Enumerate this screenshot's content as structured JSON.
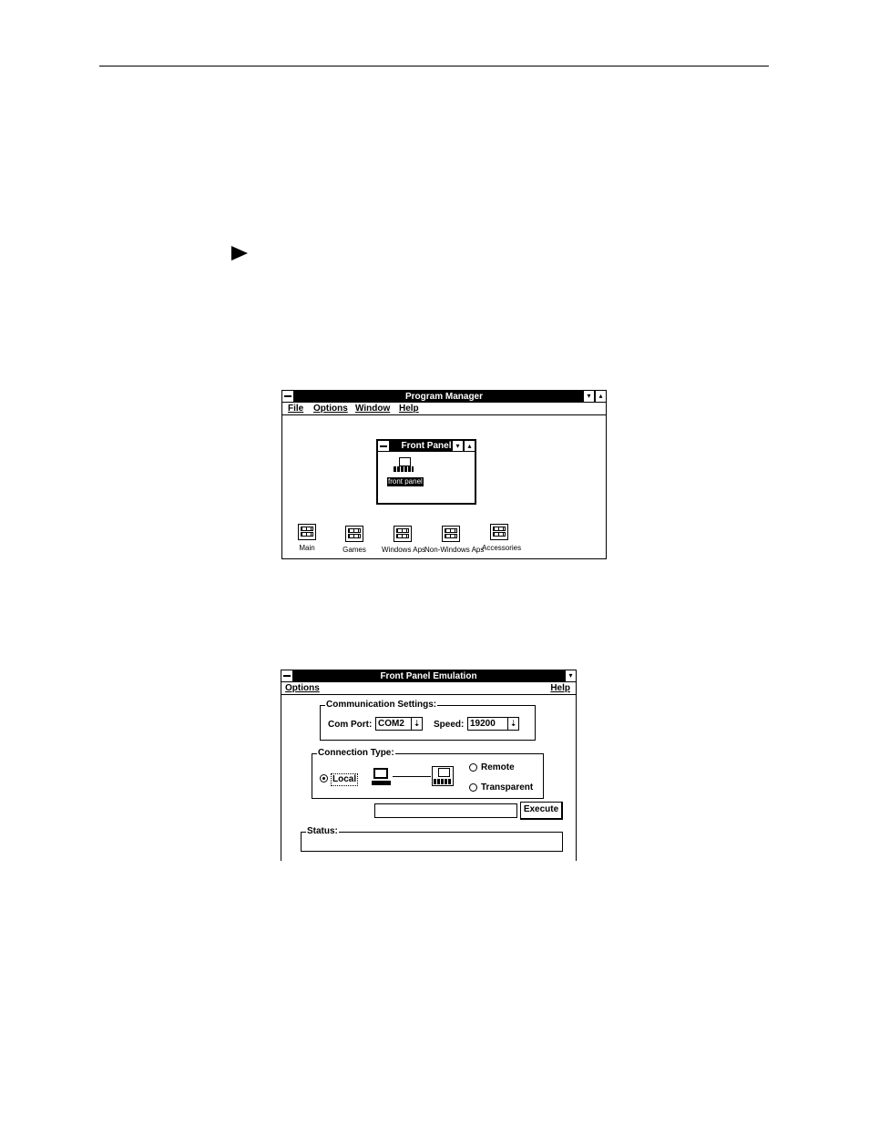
{
  "program_manager": {
    "title": "Program Manager",
    "menu": [
      "File",
      "Options",
      "Window",
      "Help"
    ],
    "front_panel_group": {
      "title": "Front Panel",
      "item_label": "front panel"
    },
    "groups": [
      "Main",
      "Games",
      "Windows Aps",
      "Non-Windows Aps",
      "Accessories"
    ]
  },
  "front_panel_emulation": {
    "title": "Front Panel Emulation",
    "menu_left": "Options",
    "menu_right": "Help",
    "communication_settings": {
      "label": "Communication Settings:",
      "com_port_label": "Com Port:",
      "com_port_value": "COM2",
      "speed_label": "Speed:",
      "speed_value": "19200"
    },
    "connection_type": {
      "label": "Connection Type:",
      "options": [
        "Local",
        "Remote",
        "Transparent"
      ],
      "selected": "Local"
    },
    "execute_label": "Execute",
    "status_label": "Status:"
  }
}
